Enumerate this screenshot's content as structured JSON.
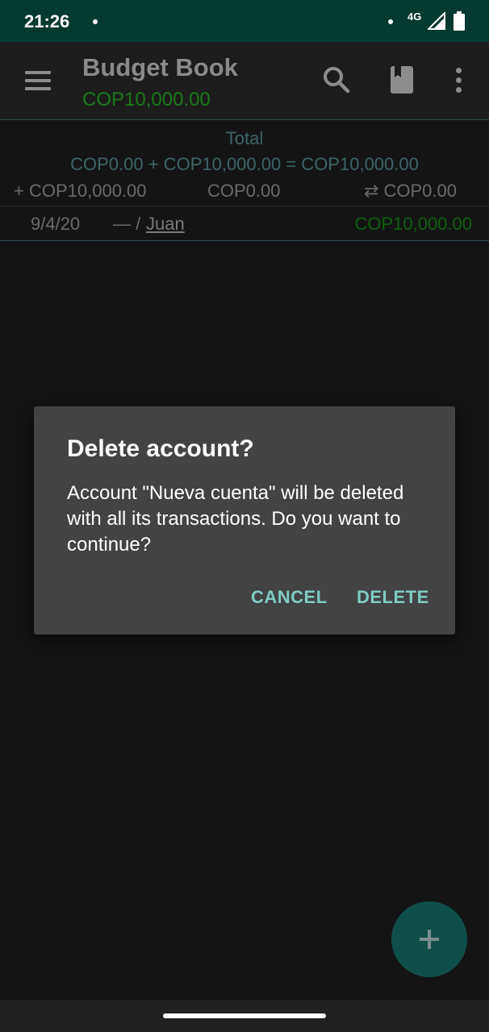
{
  "status_bar": {
    "time": "21:26",
    "network": "4G"
  },
  "app_bar": {
    "title": "Budget Book",
    "subtitle": "COP10,000.00",
    "icons": [
      "menu-icon",
      "search-icon",
      "book-icon",
      "more-vert-icon"
    ]
  },
  "totals": {
    "label": "Total",
    "equation": "COP0.00 + COP10,000.00 = COP10,000.00",
    "income": "+ COP10,000.00",
    "expense": "COP0.00",
    "transfer": "⇄ COP0.00"
  },
  "transaction": {
    "date": "9/4/20",
    "separator": "— /",
    "payee": "Juan",
    "amount": "COP10,000.00"
  },
  "dialog": {
    "title": "Delete account?",
    "message": "Account \"Nueva cuenta\" will be deleted with all its transactions. Do you want to continue?",
    "cancel_label": "CANCEL",
    "delete_label": "DELETE"
  },
  "fab": {
    "icon": "plus-icon"
  },
  "colors": {
    "status_bar": "#033a2f",
    "accent": "#80cbc4",
    "positive_amount": "#1a7a1a",
    "fab": "#0f4f4a"
  }
}
